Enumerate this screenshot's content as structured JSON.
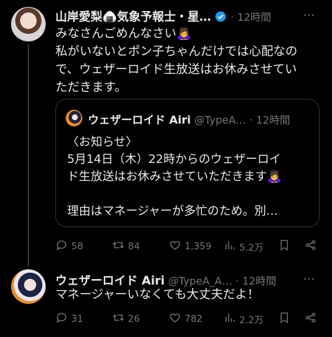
{
  "tweet1": {
    "display_name": "山岸愛梨🍙気象予報士・星…",
    "time": "· 12時間",
    "text_lines": [
      "みなさんごめんなさい🙇‍♀️",
      "私がいないとポン子ちゃんだけでは心配なの",
      "で、ウェザーロイド生放送はお休みさせてい",
      "ただきます。"
    ],
    "quote": {
      "display_name": "ウェザーロイド Airi",
      "handle": "@TypeA…",
      "time": "· 12時間",
      "lines": [
        "〈お知らせ〉",
        "5月14日（木）22時からのウェザーロイ",
        "ド生放送はお休みさせていただきます🙇‍♀️",
        "",
        "理由はマネージャーが多忙のため。別…"
      ]
    },
    "stats": {
      "replies": "58",
      "retweets": "84",
      "likes": "1,359",
      "views": "5.2万"
    }
  },
  "tweet2": {
    "display_name": "ウェザーロイド Airi",
    "handle": "@TypeA_A…",
    "time": "· 12時間",
    "text": "マネージャーいなくても大丈夫だよ！",
    "stats": {
      "replies": "31",
      "retweets": "26",
      "likes": "782",
      "views": "2.2万"
    }
  },
  "colors": {
    "background": "#000000",
    "text": "#e7e9ea",
    "muted": "#71767b",
    "verified": "#1d9bf0",
    "border": "#2f3336"
  }
}
